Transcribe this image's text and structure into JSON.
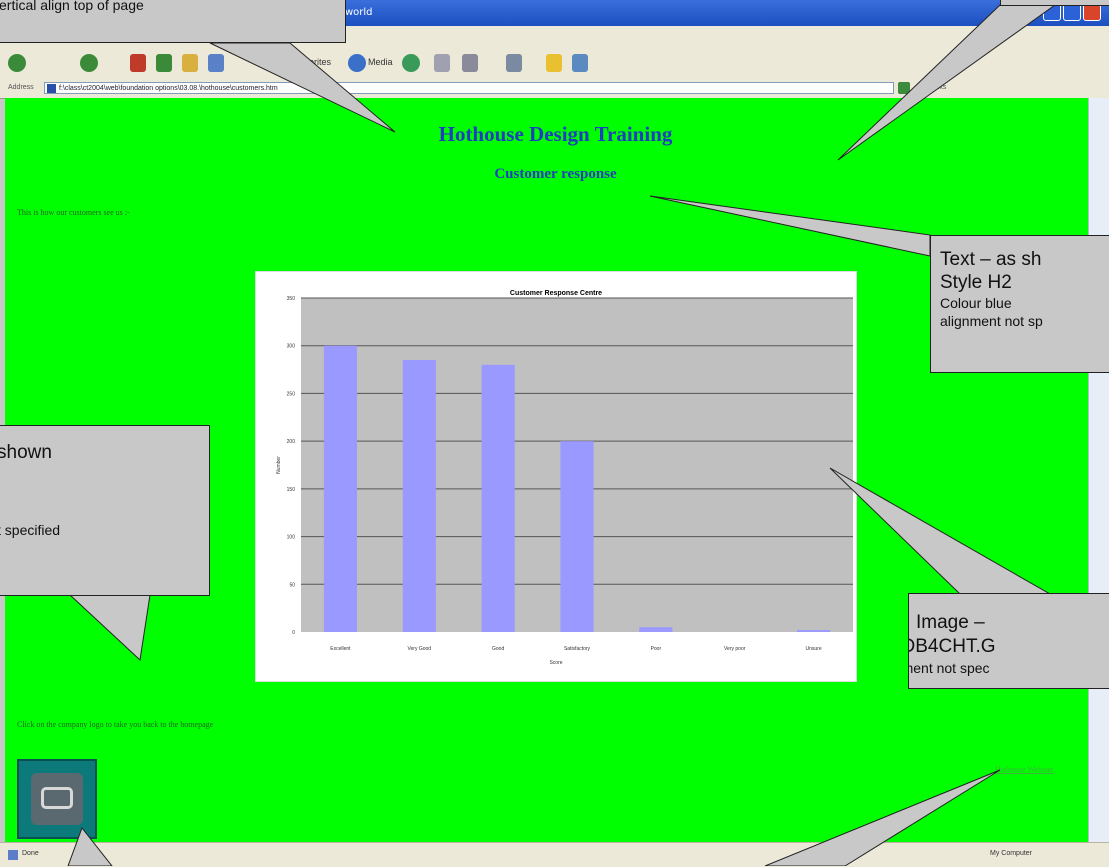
{
  "browser": {
    "title": "world",
    "address_label": "Address",
    "address_url": "f:\\class\\ct2004\\web\\foundation options\\03.08.\\hothouse\\customers.htm",
    "links_label": "Links",
    "status_left": "Done",
    "status_right": "My Computer",
    "toolbar": {
      "favorites": "Favorites",
      "media": "Media"
    }
  },
  "page": {
    "heading": "Hothouse Design Training",
    "subheading": "Customer response",
    "intro": "This is how our customers see us :-",
    "logo_instruction": "Click on the company logo to take you back to the homepage",
    "footer_link": "Hothouse Website"
  },
  "chart_data": {
    "type": "bar",
    "title": "Customer Response Centre",
    "xlabel": "Score",
    "ylabel": "Number",
    "categories": [
      "Excellent",
      "Very Good",
      "Good",
      "Satisfactory",
      "Poor",
      "Very poor",
      "Unsure"
    ],
    "values": [
      300,
      285,
      280,
      200,
      5,
      0,
      2
    ],
    "ylim": [
      0,
      350
    ],
    "yticks": [
      0,
      50,
      100,
      150,
      200,
      250,
      300,
      350
    ],
    "grid": true,
    "colors": {
      "bar": "#9999ff",
      "plot_bg": "#c0c0c0"
    }
  },
  "callouts": {
    "top_left": {
      "line1": "ertical align top of page"
    },
    "right_h2": {
      "title1": "Text – as sh",
      "title2": "Style H2",
      "detail1": "Colour blue",
      "detail2": "alignment not sp"
    },
    "left_text": {
      "title": "shown",
      "detail": "t specified"
    },
    "right_image": {
      "title1": "Image –",
      "title2": "FWDB4CHT.G",
      "detail": "alignment not spec"
    },
    "fill_color": "#c8c8c8"
  },
  "colors": {
    "page_background": "#00ff00",
    "heading": "#1f3fbf",
    "link": "#3cb43c"
  }
}
